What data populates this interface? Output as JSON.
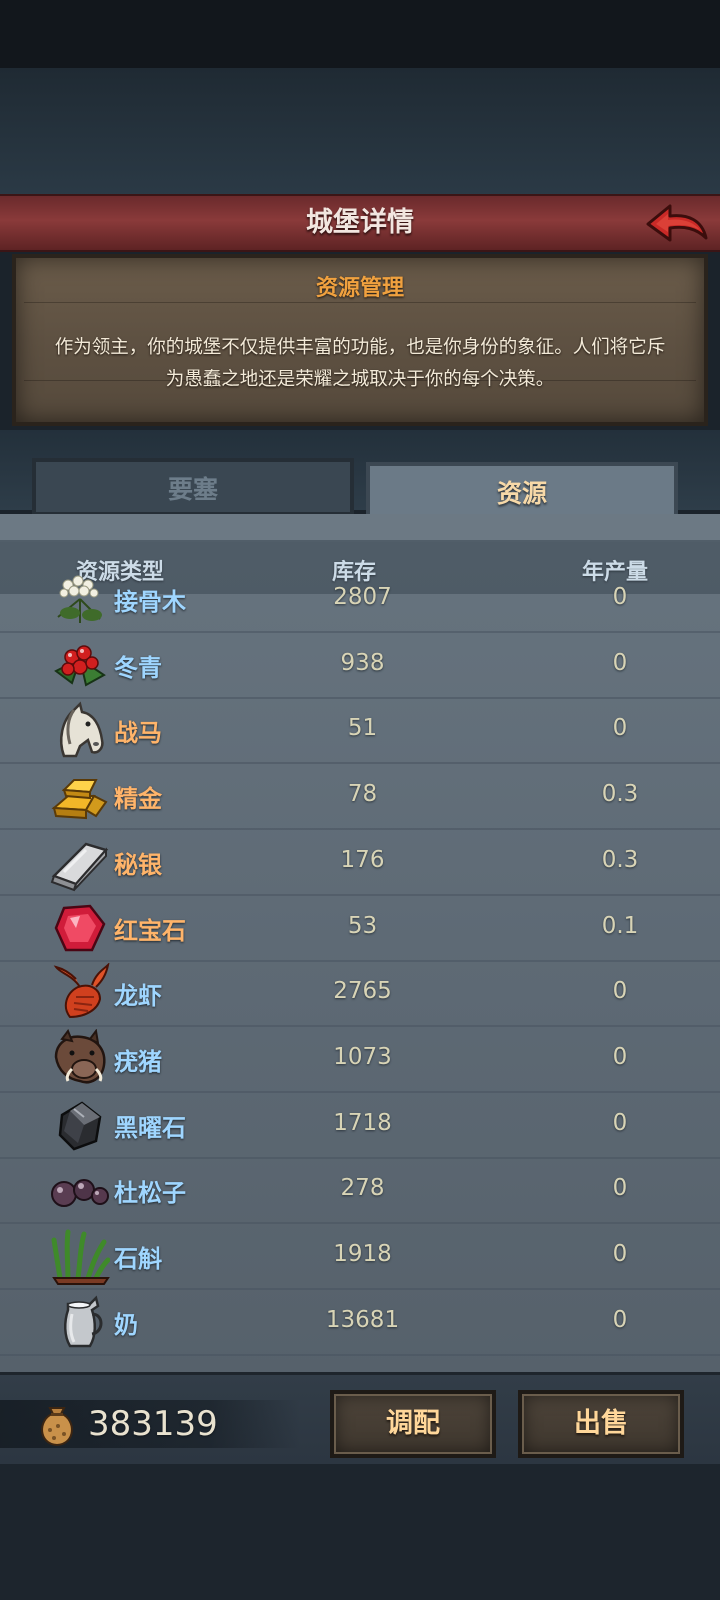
{
  "header": {
    "title": "城堡详情",
    "back_icon": "back-arrow-icon"
  },
  "intro": {
    "title": "资源管理",
    "text": "作为领主，你的城堡不仅提供丰富的功能，也是你身份的象征。人们将它斥为愚蠢之地还是荣耀之城取决于你的每个决策。"
  },
  "tabs": [
    {
      "label": "要塞",
      "active": false
    },
    {
      "label": "资源",
      "active": true
    }
  ],
  "table": {
    "headers": [
      "资源类型",
      "库存",
      "年产量"
    ],
    "rows": [
      {
        "icon": "elder-flower-icon",
        "name": "接骨木",
        "stock": "2807",
        "yield": "0",
        "color": "#9fd6ff"
      },
      {
        "icon": "holly-icon",
        "name": "冬青",
        "stock": "938",
        "yield": "0",
        "color": "#9fd6ff"
      },
      {
        "icon": "horse-icon",
        "name": "战马",
        "stock": "51",
        "yield": "0",
        "color": "#ffb46a"
      },
      {
        "icon": "gold-ingot-icon",
        "name": "精金",
        "stock": "78",
        "yield": "0.3",
        "color": "#ffb46a"
      },
      {
        "icon": "silver-ingot-icon",
        "name": "秘银",
        "stock": "176",
        "yield": "0.3",
        "color": "#ffb46a"
      },
      {
        "icon": "ruby-icon",
        "name": "红宝石",
        "stock": "53",
        "yield": "0.1",
        "color": "#ffb46a"
      },
      {
        "icon": "lobster-icon",
        "name": "龙虾",
        "stock": "2765",
        "yield": "0",
        "color": "#9fd6ff"
      },
      {
        "icon": "boar-icon",
        "name": "疣猪",
        "stock": "1073",
        "yield": "0",
        "color": "#9fd6ff"
      },
      {
        "icon": "obsidian-icon",
        "name": "黑曜石",
        "stock": "1718",
        "yield": "0",
        "color": "#9fd6ff"
      },
      {
        "icon": "juniper-berries-icon",
        "name": "杜松子",
        "stock": "278",
        "yield": "0",
        "color": "#9fd6ff"
      },
      {
        "icon": "dendrobium-icon",
        "name": "石斛",
        "stock": "1918",
        "yield": "0",
        "color": "#9fd6ff"
      },
      {
        "icon": "milk-jug-icon",
        "name": "奶",
        "stock": "13681",
        "yield": "0",
        "color": "#9fd6ff"
      }
    ]
  },
  "footer": {
    "gold_icon": "gold-sack-icon",
    "gold": "383139",
    "allocate_label": "调配",
    "sell_label": "出售"
  }
}
